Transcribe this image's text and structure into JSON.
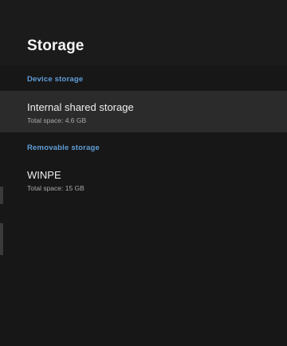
{
  "header": {
    "title": "Storage"
  },
  "sections": [
    {
      "heading": "Device storage",
      "items": [
        {
          "title": "Internal shared storage",
          "subtitle": "Total space: 4.6 GB",
          "selected": true
        }
      ]
    },
    {
      "heading": "Removable storage",
      "items": [
        {
          "title": "WINPE",
          "subtitle": "Total space: 15 GB",
          "selected": false
        }
      ]
    }
  ],
  "colors": {
    "background": "#171717",
    "header": "#1b1b1b",
    "selected_row": "#2b2b2b",
    "section_accent": "#5f9ed8",
    "primary_text": "#eeeeee",
    "secondary_text": "#a9a9a9"
  }
}
